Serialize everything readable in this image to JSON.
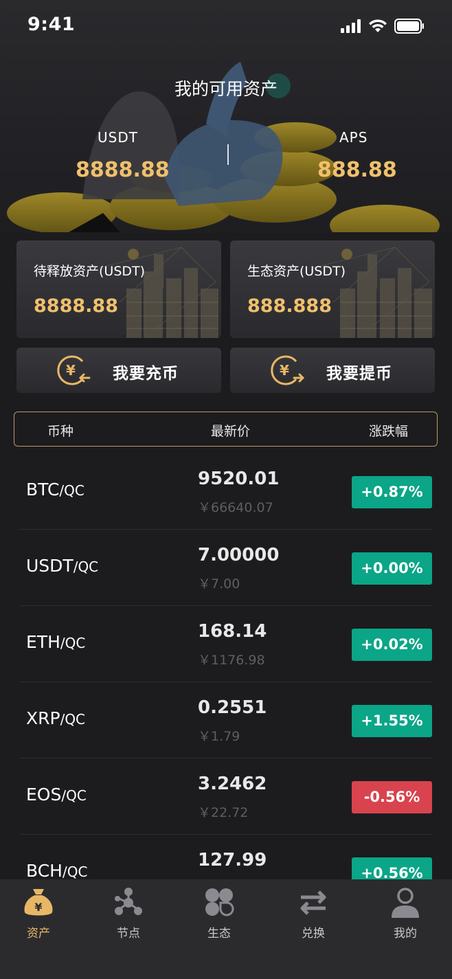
{
  "status": {
    "time": "9:41"
  },
  "hero": {
    "title": "我的可用资产",
    "left": {
      "label": "USDT",
      "value": "8888.88"
    },
    "right": {
      "label": "APS",
      "value": "888.88"
    }
  },
  "cards": [
    {
      "label": "待释放资产(USDT)",
      "value": "8888.88"
    },
    {
      "label": "生态资产(USDT)",
      "value": "888.888"
    }
  ],
  "actions": {
    "deposit": "我要充币",
    "withdraw": "我要提币"
  },
  "table": {
    "headers": [
      "币种",
      "最新价",
      "涨跌幅"
    ],
    "rows": [
      {
        "base": "BTC",
        "quote": "/QC",
        "price": "9520.01",
        "cny": "￥66640.07",
        "change": "+0.87%",
        "dir": "up"
      },
      {
        "base": "USDT",
        "quote": "/QC",
        "price": "7.00000",
        "cny": "￥7.00",
        "change": "+0.00%",
        "dir": "up"
      },
      {
        "base": "ETH",
        "quote": "/QC",
        "price": "168.14",
        "cny": "￥1176.98",
        "change": "+0.02%",
        "dir": "up"
      },
      {
        "base": "XRP",
        "quote": "/QC",
        "price": "0.2551",
        "cny": "￥1.79",
        "change": "+1.55%",
        "dir": "up"
      },
      {
        "base": "EOS",
        "quote": "/QC",
        "price": "3.2462",
        "cny": "￥22.72",
        "change": "-0.56%",
        "dir": "down"
      },
      {
        "base": "BCH",
        "quote": "/QC",
        "price": "127.99",
        "cny": "",
        "change": "+0.56%",
        "dir": "up"
      }
    ]
  },
  "colors": {
    "up": "#0ba587",
    "down": "#d8434e",
    "gold": "#f0c06c",
    "tab_active": "#e8b766",
    "tab_inactive": "#8a8a90"
  },
  "tabbar": {
    "items": [
      {
        "label": "资产",
        "icon": "money-bag-icon",
        "active": true
      },
      {
        "label": "节点",
        "icon": "node-network-icon",
        "active": false
      },
      {
        "label": "生态",
        "icon": "clover-grid-icon",
        "active": false
      },
      {
        "label": "兑换",
        "icon": "exchange-arrows-icon",
        "active": false
      },
      {
        "label": "我的",
        "icon": "user-icon",
        "active": false
      }
    ]
  }
}
